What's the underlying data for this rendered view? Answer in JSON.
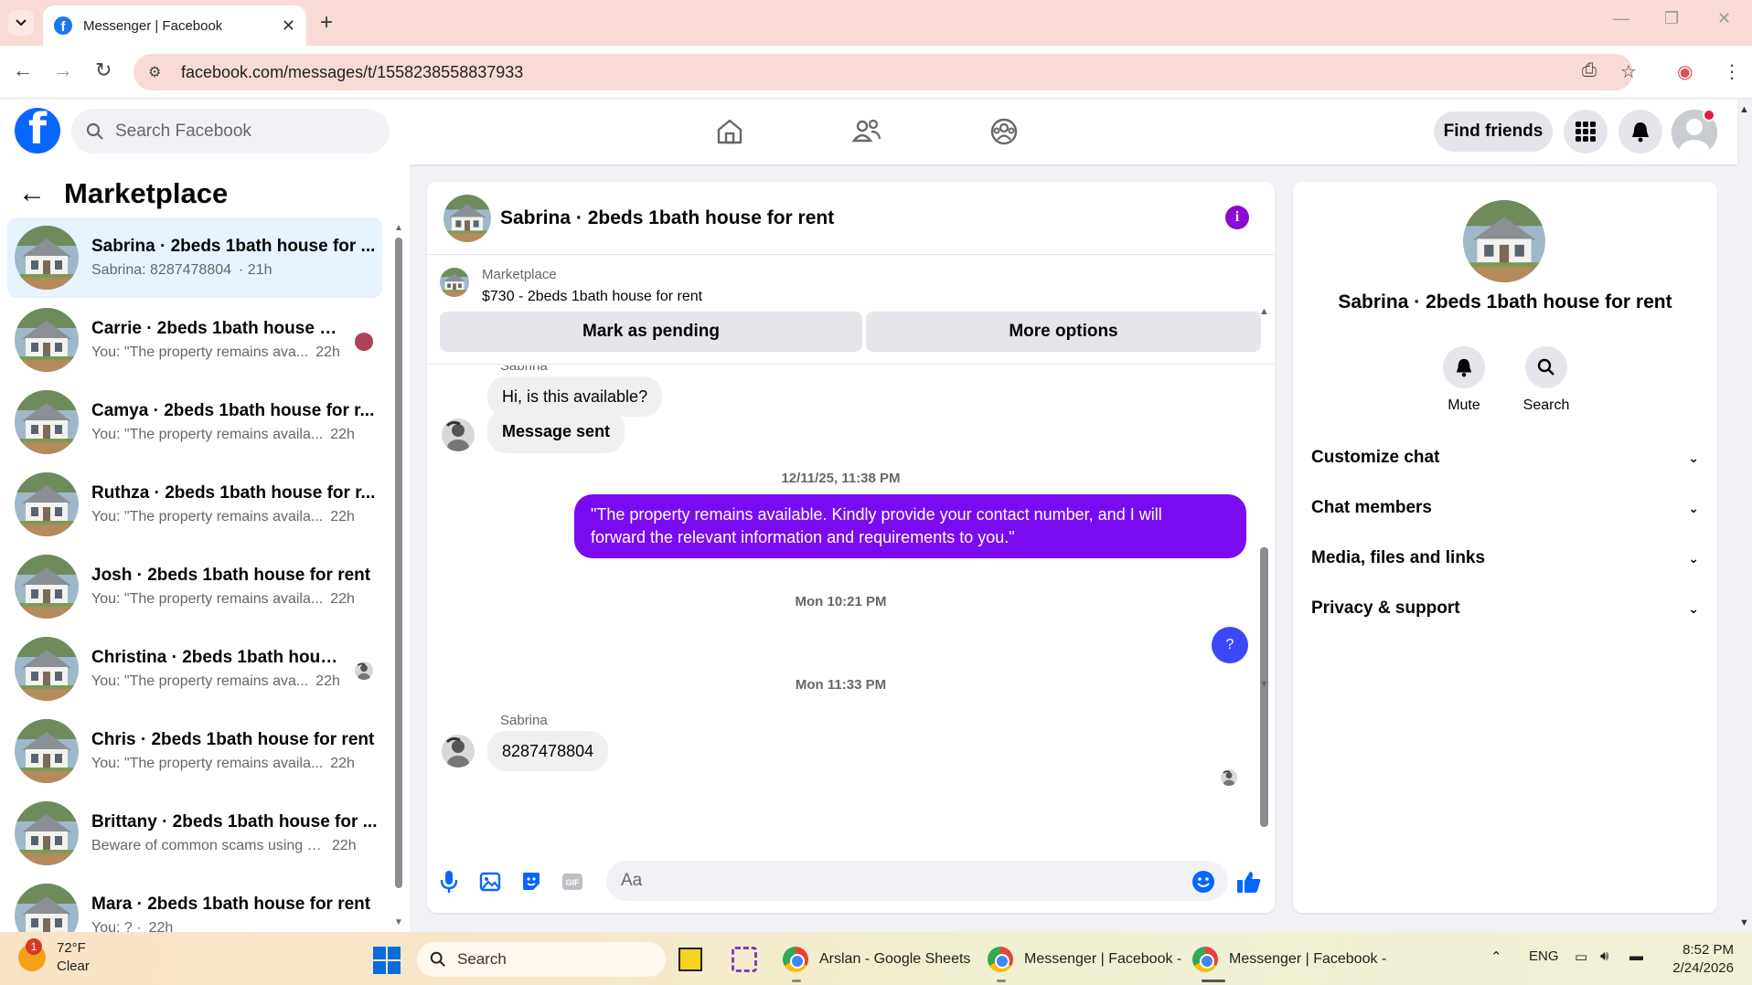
{
  "browser": {
    "tab_title": "Messenger | Facebook",
    "url": "facebook.com/messages/t/1558238558837933"
  },
  "fb": {
    "search_placeholder": "Search Facebook",
    "find_friends": "Find friends"
  },
  "left": {
    "title": "Marketplace",
    "chats": [
      {
        "name": "Sabrina · 2beds 1bath house for ...",
        "preview": "Sabrina: 8287478804",
        "time": "· 21h"
      },
      {
        "name": "Carrie · 2beds 1bath house for...",
        "preview": "You: \"The property remains ava...",
        "time": "22h"
      },
      {
        "name": "Camya · 2beds 1bath house for r...",
        "preview": "You: \"The property remains availa...",
        "time": "22h"
      },
      {
        "name": "Ruthza · 2beds 1bath house for r...",
        "preview": "You: \"The property remains availa...",
        "time": "22h"
      },
      {
        "name": "Josh · 2beds 1bath house for rent",
        "preview": "You: \"The property remains availa...",
        "time": "22h"
      },
      {
        "name": "Christina · 2beds 1bath house ...",
        "preview": "You: \"The property remains ava...",
        "time": "22h"
      },
      {
        "name": "Chris · 2beds 1bath house for rent",
        "preview": "You: \"The property remains availa...",
        "time": "22h"
      },
      {
        "name": "Brittany · 2beds 1bath house for ...",
        "preview": "Beware of common scams using p...",
        "time": "22h"
      },
      {
        "name": "Mara · 2beds 1bath house for rent",
        "preview": "You: ? ·",
        "time": "22h"
      }
    ]
  },
  "convo": {
    "title": "Sabrina · 2beds 1bath house for rent",
    "marketplace_label": "Marketplace",
    "listing": "$730 - 2beds 1bath house for rent",
    "mark_pending": "Mark as pending",
    "more_options": "More options",
    "partial_sender": "Sabrina",
    "msg1": "Hi, is this available?",
    "msg2": "Message sent",
    "time1": "12/11/25, 11:38 PM",
    "out1_line1": "\"The property remains available. Kindly provide your contact number, and I will",
    "out1_line2": "forward the relevant information and requirements to you.\"",
    "time2": "Mon 10:21 PM",
    "out2": "?",
    "time3": "Mon 11:33 PM",
    "sender": "Sabrina",
    "msg3": "8287478804",
    "composer_placeholder": "Aa"
  },
  "right": {
    "name": "Sabrina · 2beds 1bath house for rent",
    "mute": "Mute",
    "search": "Search",
    "rows": [
      "Customize chat",
      "Chat members",
      "Media, files and links",
      "Privacy & support"
    ]
  },
  "taskbar": {
    "temp": "72°F",
    "cond": "Clear",
    "weather_badge": "1",
    "search": "Search",
    "app1": "Arslan - Google Sheets",
    "app2": "Messenger | Facebook -",
    "app3": "Messenger | Facebook -",
    "lang": "ENG",
    "time": "8:52 PM",
    "date": "2/24/2026"
  },
  "colors": {
    "fb_blue": "#0866ff",
    "messenger_purple": "#7a0bf0",
    "active_chat": "#e7f3ff"
  }
}
